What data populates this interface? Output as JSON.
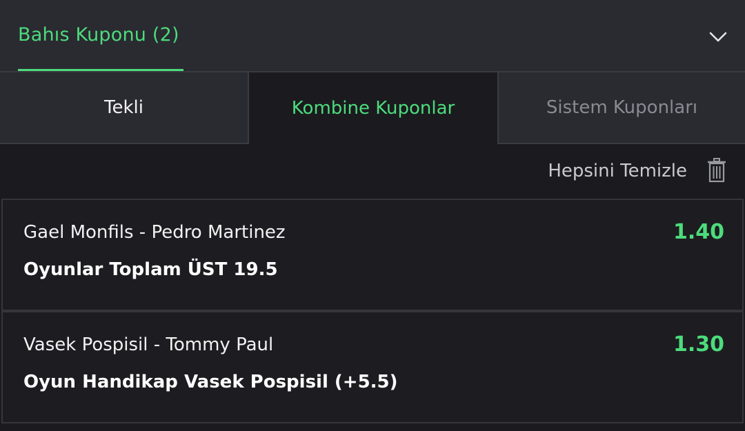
{
  "colors": {
    "accent": "#4cdc7c",
    "background": "#1b1b1f",
    "panel": "#2a2a31",
    "muted_text": "#8a8a92"
  },
  "header": {
    "title": "Bahıs Kuponu (2)",
    "toggle_icon": "chevron-down-icon"
  },
  "tabs": [
    {
      "label": "Tekli",
      "active": false
    },
    {
      "label": "Kombine Kuponlar",
      "active": true
    },
    {
      "label": "Sistem Kuponları",
      "active": false,
      "disabled": true
    }
  ],
  "actions": {
    "clear_all_label": "Hepsini Temizle",
    "clear_all_icon": "trash-icon"
  },
  "bets": [
    {
      "match": "Gael Monfils - Pedro Martinez",
      "selection": "Oyunlar Toplam ÜST 19.5",
      "odds": "1.40"
    },
    {
      "match": "Vasek Pospisil - Tommy Paul",
      "selection": "Oyun Handikap Vasek Pospisil (+5.5)",
      "odds": "1.30"
    }
  ]
}
